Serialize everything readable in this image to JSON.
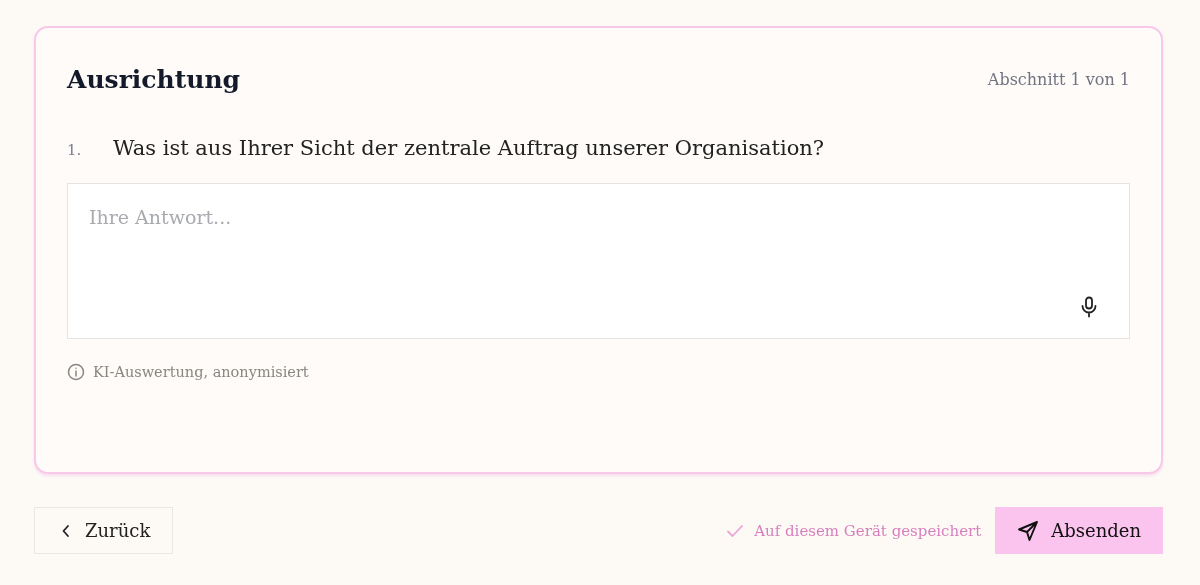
{
  "section": {
    "title": "Ausrichtung",
    "progress": "Abschnitt 1 von 1"
  },
  "questions": [
    {
      "number": "1.",
      "text": "Was ist aus Ihrer Sicht der zentrale Auftrag unserer Organisation?",
      "placeholder": "Ihre Antwort..."
    }
  ],
  "note": "KI-Auswertung, anonymisiert",
  "footer": {
    "back": "Zurück",
    "status": "Auf diesem Gerät gespeichert",
    "submit": "Absenden"
  }
}
